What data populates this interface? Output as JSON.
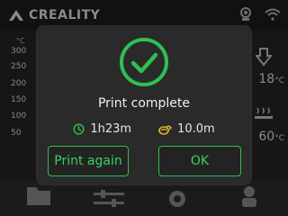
{
  "header": {
    "brand": "CREALITY",
    "icons": [
      "camera-icon",
      "wifi-icon"
    ]
  },
  "background": {
    "temp_unit": "°C",
    "axis_ticks": [
      "300",
      "250",
      "200",
      "150",
      "100",
      "50"
    ],
    "right_temps": [
      {
        "value": "18",
        "unit": "°C"
      },
      {
        "value": "60",
        "unit": "°C"
      }
    ]
  },
  "modal": {
    "title": "Print complete",
    "duration": "1h23m",
    "filament": "10.0m",
    "buttons": {
      "print_again": "Print again",
      "ok": "OK"
    }
  },
  "colors": {
    "accent": "#2fbf52",
    "modal_bg": "#2a2a2a",
    "screen_bg": "#151515"
  }
}
